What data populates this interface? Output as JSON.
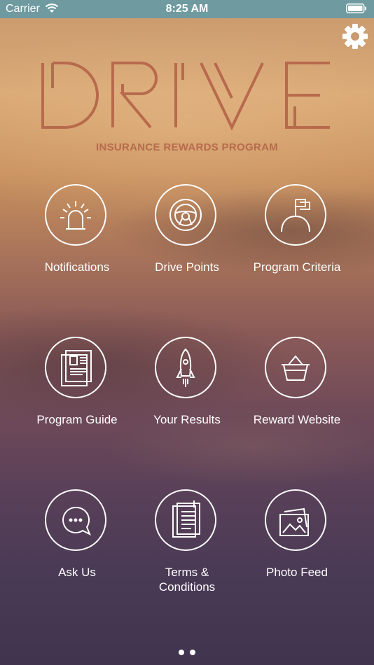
{
  "status_bar": {
    "carrier": "Carrier",
    "time": "8:25 AM"
  },
  "header": {
    "logo_text": "DRIVE",
    "subtitle": "INSURANCE REWARDS PROGRAM",
    "settings_icon": "gear-icon",
    "logo_color": "#b86a4c"
  },
  "menu": {
    "notifications": {
      "label": "Notifications",
      "icon": "alarm-light-icon"
    },
    "drive_points": {
      "label": "Drive Points",
      "icon": "steering-wheel-icon"
    },
    "program_criteria": {
      "label": "Program Criteria",
      "icon": "flag-hill-icon"
    },
    "program_guide": {
      "label": "Program Guide",
      "icon": "document-guide-icon"
    },
    "your_results": {
      "label": "Your Results",
      "icon": "rocket-icon"
    },
    "reward_website": {
      "label": "Reward Website",
      "icon": "basket-icon"
    },
    "ask_us": {
      "label": "Ask Us",
      "icon": "chat-bubble-icon"
    },
    "terms_line1": "Terms &",
    "terms_line2": "Conditions",
    "terms_icon": "clipboard-document-icon",
    "photo_feed": {
      "label": "Photo Feed",
      "icon": "photos-icon"
    }
  },
  "pagination": {
    "pages": 2,
    "current": 1
  }
}
